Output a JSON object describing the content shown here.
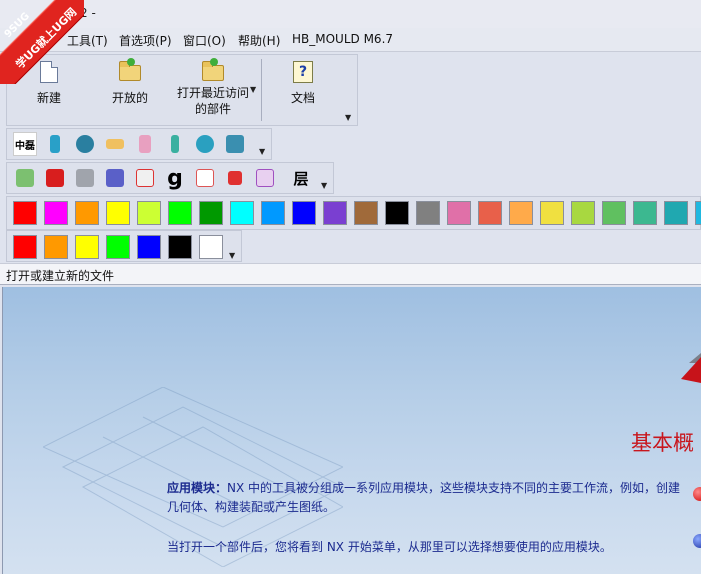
{
  "titlebar": {
    "title": "2 -"
  },
  "badge": {
    "line1": "9SUG",
    "line2": "学UG就上UG网"
  },
  "menu": [
    {
      "label": "工具(T)"
    },
    {
      "label": "首选项(P)"
    },
    {
      "label": "窗口(O)"
    },
    {
      "label": "帮助(H)"
    },
    {
      "label": "HB_MOULD M6.7"
    }
  ],
  "menu_partial": "",
  "standard_toolbar": {
    "new_label": "新建",
    "open_label": "开放的",
    "recent_label_1": "打开最近访问",
    "recent_label_2": "的部件",
    "doc_label": "文档"
  },
  "toolbar_mould": {
    "first_label": "中磊",
    "icons": [
      "mould-wizard-icon",
      "ejector-pin-icon",
      "cooling-icon",
      "sprue-icon",
      "slide-icon",
      "screw-icon",
      "gate-icon",
      "mould-base-icon"
    ]
  },
  "toolbar_view": {
    "icons": [
      "view-fit-icon",
      "red-cube-icon",
      "grey-box-icon",
      "blue-box-icon",
      "section-icon",
      "g-letter-icon",
      "wireframe-icon",
      "shaded-cube-icon",
      "camera-icon",
      "layer-icon"
    ],
    "g_label": "g",
    "layer_label": "层"
  },
  "palette_large": {
    "colors": [
      "#ff0000",
      "#ff00ff",
      "#ff9900",
      "#ffff00",
      "#ccff33",
      "#00ff00",
      "#009900",
      "#00ffff",
      "#0099ff",
      "#0000ff",
      "#7a3fd1",
      "#a06a3a",
      "#000000",
      "#808080",
      "#e070a8",
      "#e8604a",
      "#ffaa4a",
      "#f0e040",
      "#a8d840",
      "#60c060",
      "#3cb890",
      "#20a8b0",
      "#20b8e0"
    ]
  },
  "palette_small": {
    "colors": [
      "#ff0000",
      "#ff9900",
      "#ffff00",
      "#00ff00",
      "#0000ff",
      "#000000",
      "#ffffff"
    ]
  },
  "panel": {
    "header": "打开或建立新的文件"
  },
  "content": {
    "heading": "基本概",
    "para1_bold": "应用模块：",
    "para1_text": "NX 中的工具被分组成一系列应用模块，这些模块支持不同的主要工作流，例如，创建几何体、构建装配或产生图纸。",
    "para2_text": "当打开一个部件后，您将看到 NX 开始菜单，从那里可以选择想要使用的应用模块。"
  }
}
